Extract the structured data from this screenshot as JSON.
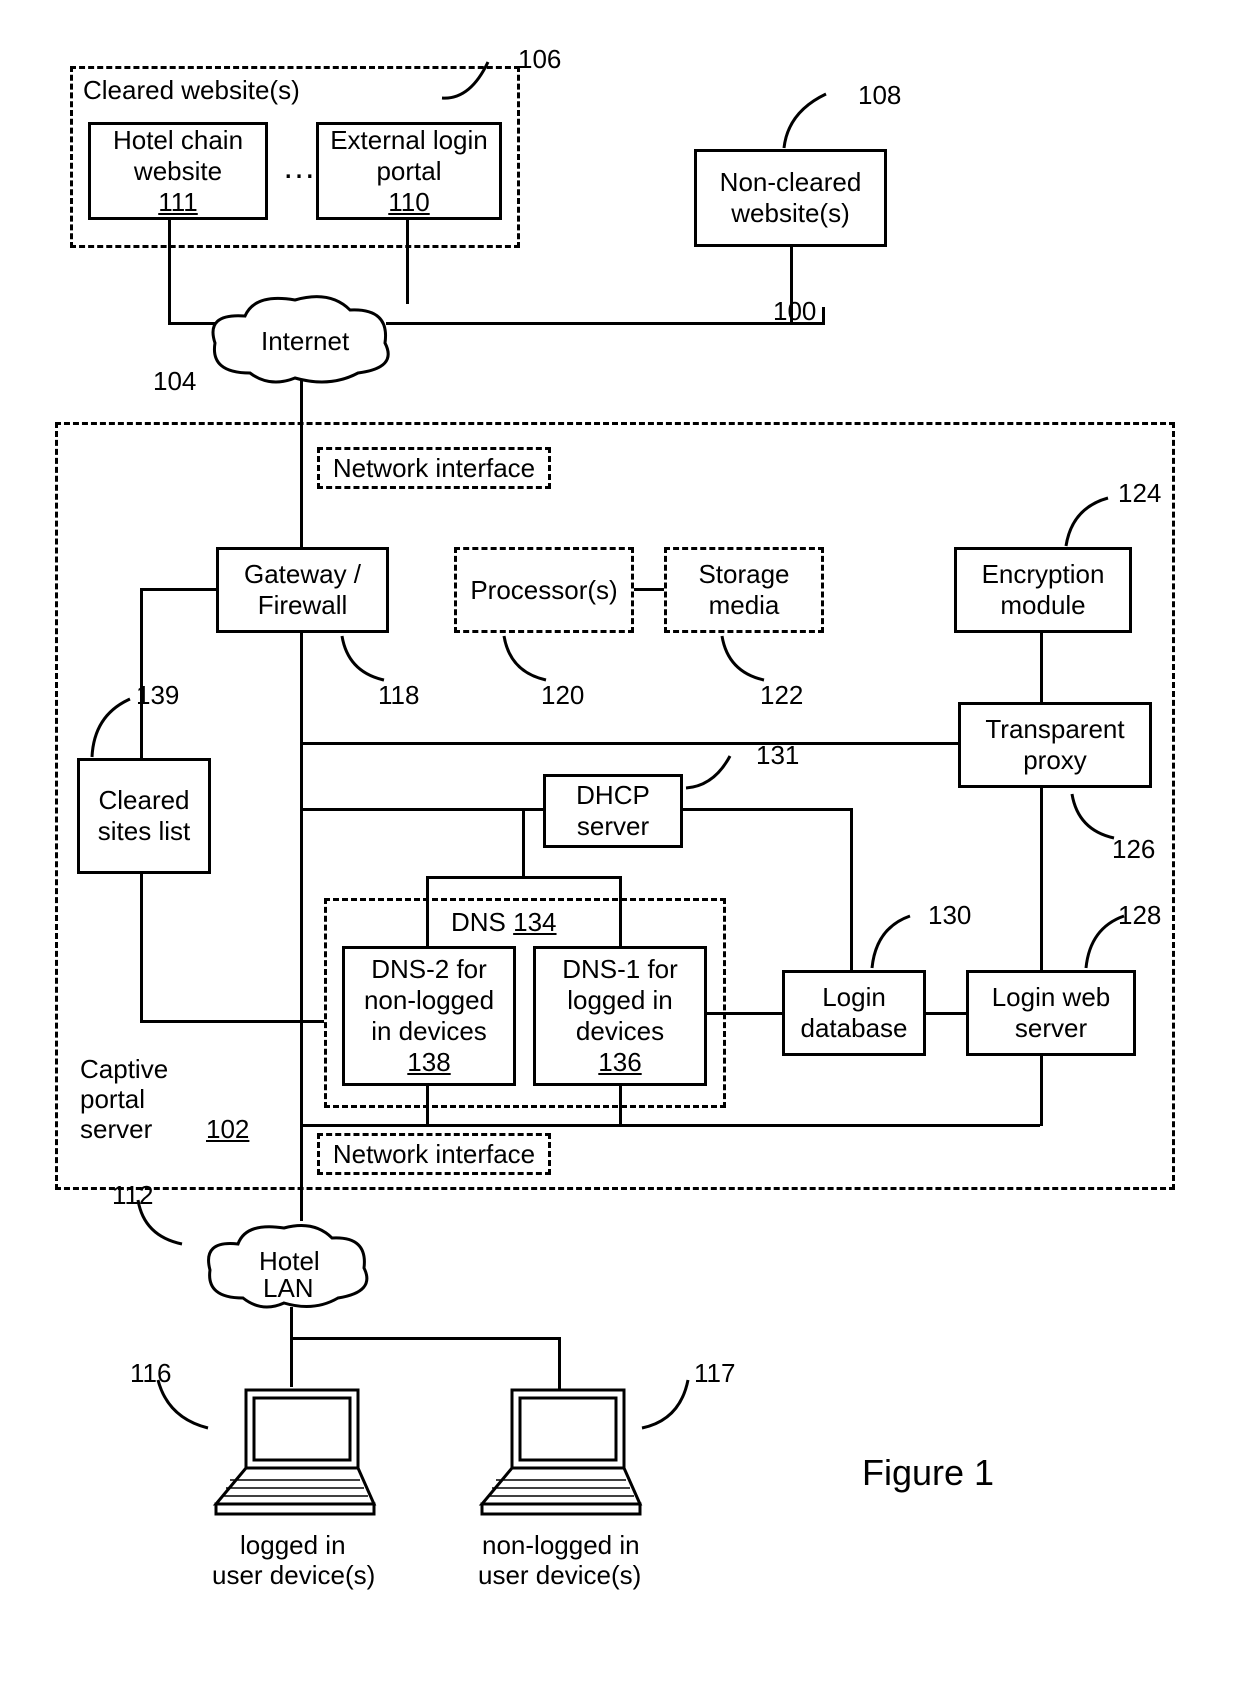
{
  "figure_label": "Figure 1",
  "refs": {
    "system": "100",
    "captive_portal": "102",
    "internet": "104",
    "cleared_sites": "106",
    "non_cleared": "108",
    "external_portal": "110",
    "hotel_chain": "111",
    "hotel_lan": "112",
    "logged_device": "116",
    "nonlogged_device": "117",
    "gateway": "118",
    "processors": "120",
    "storage": "122",
    "encryption": "124",
    "proxy": "126",
    "login_server": "128",
    "login_db": "130",
    "dhcp": "131",
    "dns": "134",
    "dns1": "136",
    "dns2": "138",
    "cleared_list": "139"
  },
  "blocks": {
    "cleared_group": "Cleared website(s)",
    "hotel_chain": "Hotel chain website",
    "external_portal": "External login portal",
    "non_cleared": "Non-cleared website(s)",
    "internet": "Internet",
    "net_if": "Network interface",
    "gateway_l1": "Gateway /",
    "gateway_l2": "Firewall",
    "processors": "Processor(s)",
    "storage": "Storage media",
    "encryption": "Encryption module",
    "cleared_list": "Cleared sites list",
    "dhcp": "DHCP server",
    "proxy": "Transparent proxy",
    "dns": "DNS",
    "dns2_l1": "DNS-2 for",
    "dns2_l2": "non-logged",
    "dns2_l3": "in devices",
    "dns1_l1": "DNS-1 for",
    "dns1_l2": "logged in",
    "dns1_l3": "devices",
    "login_db": "Login database",
    "login_server": "Login web server",
    "captive_l1": "Captive",
    "captive_l2": "portal",
    "captive_l3": "server",
    "hotel_lan_l1": "Hotel",
    "hotel_lan_l2": "LAN",
    "logged_l1": "logged in",
    "logged_l2": "user device(s)",
    "nonlogged_l1": "non-logged in",
    "nonlogged_l2": "user device(s)",
    "ellipsis": "…"
  }
}
